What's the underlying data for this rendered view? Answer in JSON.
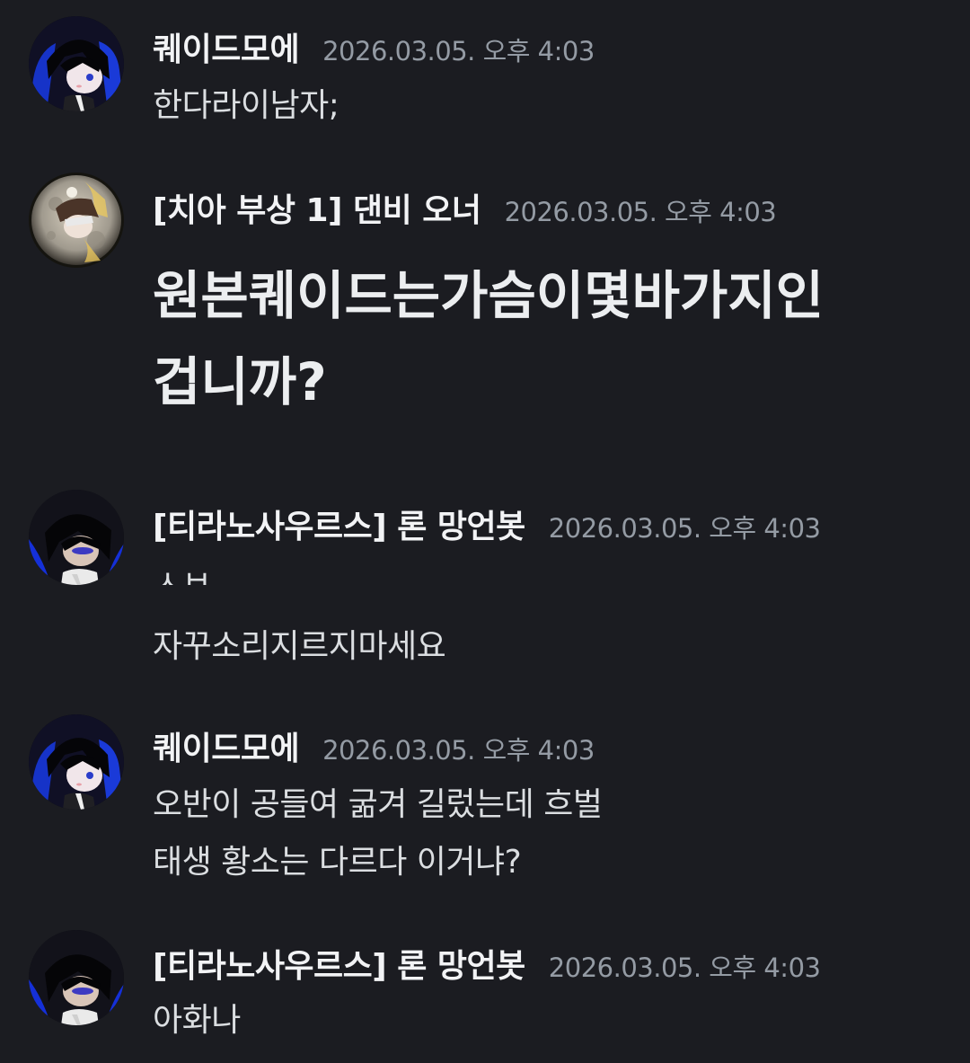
{
  "messages": [
    {
      "username": "퀘이드모에",
      "timestamp": "2026.03.05. 오후 4:03",
      "avatar": "dark-haired-character-avatar",
      "lines": [
        "한다라이남자;"
      ]
    },
    {
      "username": "[치아 부상 1] 댄비 오너",
      "timestamp": "2026.03.05. 오후 4:03",
      "avatar": "moon-character-avatar",
      "lines": [
        "원본퀘이드는가슴이몇바가지인",
        "겁니까?"
      ]
    },
    {
      "username": "[티라노사우르스] 론 망언봇",
      "timestamp": "2026.03.05. 오후 4:03",
      "avatar": "dark-haired-character-avatar",
      "lines": [
        "ㅅㅂ",
        "자꾸소리지르지마세요"
      ]
    },
    {
      "username": "퀘이드모에",
      "timestamp": "2026.03.05. 오후 4:03",
      "avatar": "dark-haired-character-avatar",
      "lines": [
        "오반이 공들여 굶겨 길렀는데 흐벌",
        "태생 황소는 다르다 이거냐?"
      ]
    },
    {
      "username": "[티라노사우르스] 론 망언봇",
      "timestamp": "2026.03.05. 오후 4:03",
      "avatar": "dark-haired-character-avatar",
      "lines": [
        "아화나"
      ]
    }
  ]
}
